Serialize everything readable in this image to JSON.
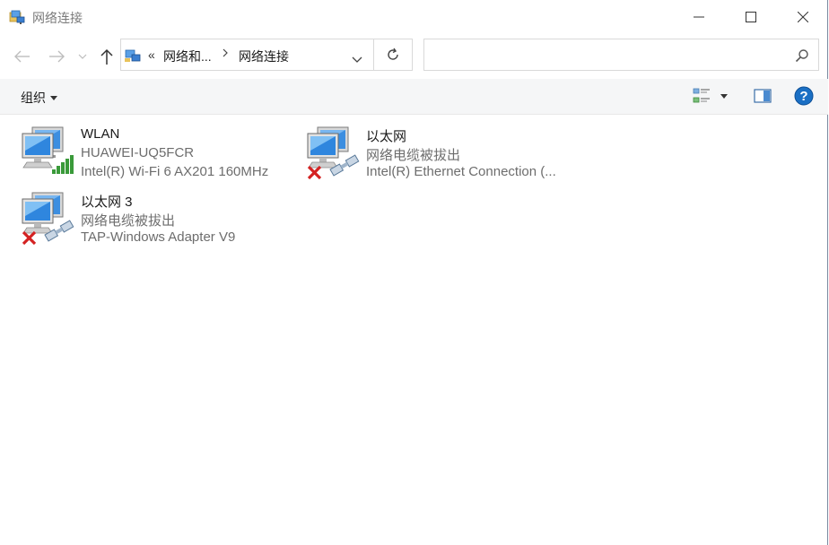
{
  "window": {
    "title": "网络连接"
  },
  "address": {
    "overflow": "«",
    "parent": "网络和...",
    "current": "网络连接"
  },
  "search": {
    "placeholder": "",
    "value": ""
  },
  "command_bar": {
    "organize_label": "组织"
  },
  "connections": [
    {
      "name": "WLAN",
      "status": "HUAWEI-UQ5FCR",
      "device": "Intel(R) Wi-Fi 6 AX201 160MHz",
      "icon": "wifi-adapter-icon",
      "state": "connected"
    },
    {
      "name": "以太网",
      "status": "网络电缆被拔出",
      "device": "Intel(R) Ethernet Connection (...",
      "icon": "ethernet-adapter-icon",
      "state": "disconnected"
    },
    {
      "name": "以太网 3",
      "status": "网络电缆被拔出",
      "device": "TAP-Windows Adapter V9",
      "icon": "ethernet-adapter-icon",
      "state": "disconnected"
    }
  ],
  "colors": {
    "accent": "#0063b1",
    "signal": "#3a9a3a",
    "error": "#d42222"
  }
}
